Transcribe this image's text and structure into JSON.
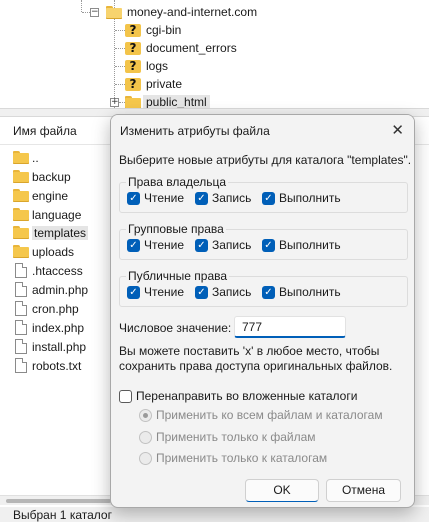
{
  "tree": {
    "root_label": "money-and-internet.com",
    "children": [
      {
        "label": "cgi-bin",
        "icon": "question-folder-icon"
      },
      {
        "label": "document_errors",
        "icon": "question-folder-icon"
      },
      {
        "label": "logs",
        "icon": "question-folder-icon"
      },
      {
        "label": "private",
        "icon": "question-folder-icon"
      },
      {
        "label": "public_html",
        "icon": "folder-icon"
      }
    ],
    "expander_minus": "−",
    "expander_plus": "+",
    "unknown_glyph": "?"
  },
  "filelist": {
    "column_header": "Имя файла",
    "items": [
      {
        "name": "..",
        "type": "folder"
      },
      {
        "name": "backup",
        "type": "folder"
      },
      {
        "name": "engine",
        "type": "folder"
      },
      {
        "name": "language",
        "type": "folder"
      },
      {
        "name": "templates",
        "type": "folder"
      },
      {
        "name": "uploads",
        "type": "folder"
      },
      {
        "name": ".htaccess",
        "type": "file"
      },
      {
        "name": "admin.php",
        "type": "file"
      },
      {
        "name": "cron.php",
        "type": "file"
      },
      {
        "name": "index.php",
        "type": "file"
      },
      {
        "name": "install.php",
        "type": "file"
      },
      {
        "name": "robots.txt",
        "type": "file"
      }
    ],
    "status": "Выбран 1 каталог"
  },
  "dialog": {
    "title": "Изменить атрибуты файла",
    "close_glyph": "✕",
    "prompt": "Выберите новые атрибуты для каталога \"templates\".",
    "check_glyph": "✓",
    "groups": [
      {
        "title": "Права владельца",
        "read": "Чтение",
        "write": "Запись",
        "exec": "Выполнить"
      },
      {
        "title": "Групповые права",
        "read": "Чтение",
        "write": "Запись",
        "exec": "Выполнить"
      },
      {
        "title": "Публичные права",
        "read": "Чтение",
        "write": "Запись",
        "exec": "Выполнить"
      }
    ],
    "numeric_label": "Числовое значение:",
    "numeric_value": "777",
    "hint_line1": "Вы можете поставить 'x' в любое место, чтобы",
    "hint_line2": "сохранить права доступа оригинальных файлов.",
    "recurse_label": "Перенаправить во вложенные каталоги",
    "radios": [
      "Применить ко всем файлам и каталогам",
      "Применить только к файлам",
      "Применить только к каталогам"
    ],
    "ok": "OK",
    "cancel": "Отмена"
  },
  "colors": {
    "accent": "#005fb8",
    "folder": "#f5c74c",
    "dialog_bg": "#f3f3f3"
  }
}
